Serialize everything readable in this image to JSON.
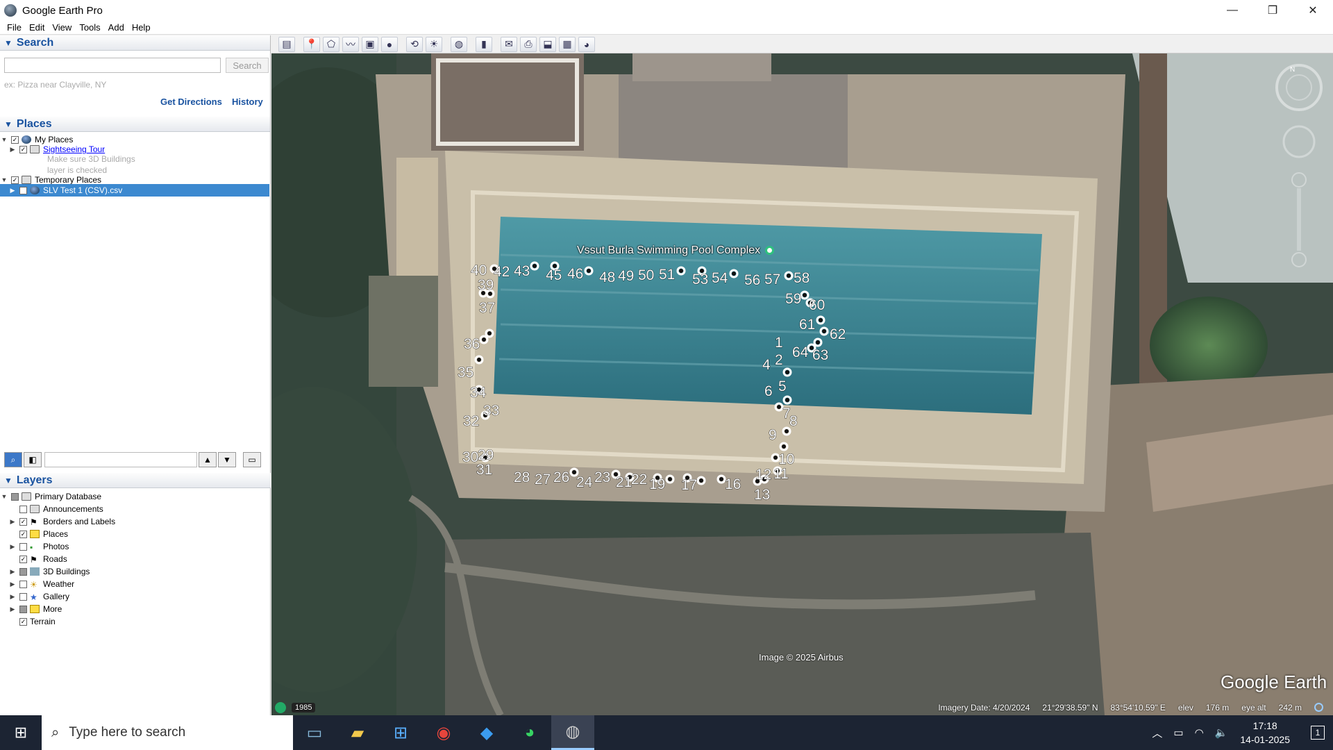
{
  "window": {
    "title": "Google Earth Pro",
    "minimize": "—",
    "maximize": "❐",
    "close": "✕"
  },
  "menu": [
    "File",
    "Edit",
    "View",
    "Tools",
    "Add",
    "Help"
  ],
  "search": {
    "header": "Search",
    "input_value": "",
    "button": "Search",
    "hint": "ex: Pizza near Clayville, NY",
    "get_directions": "Get Directions",
    "history": "History"
  },
  "places": {
    "header": "Places",
    "items": [
      {
        "label": "My Places",
        "checked": true,
        "expanded": true
      },
      {
        "label": "Sightseeing Tour",
        "checked": true,
        "link": true
      },
      {
        "label": "Make sure 3D Buildings"
      },
      {
        "label": "layer is checked"
      },
      {
        "label": "Temporary Places",
        "checked": true,
        "expanded": true
      },
      {
        "label": "SLV Test 1 (CSV).csv",
        "checked": true,
        "selected": true
      }
    ]
  },
  "layers": {
    "header": "Layers",
    "items": [
      {
        "label": "Primary Database",
        "checked": "partial"
      },
      {
        "label": "Announcements",
        "checked": false
      },
      {
        "label": "Borders and Labels",
        "checked": true
      },
      {
        "label": "Places",
        "checked": true
      },
      {
        "label": "Photos",
        "checked": false
      },
      {
        "label": "Roads",
        "checked": true
      },
      {
        "label": "3D Buildings",
        "checked": "partial"
      },
      {
        "label": "Weather",
        "checked": false
      },
      {
        "label": "Gallery",
        "checked": false
      },
      {
        "label": "More",
        "checked": "partial"
      },
      {
        "label": "Terrain",
        "checked": true
      }
    ]
  },
  "toolbar_icons": [
    "sidebar-toggle-icon",
    "placemark-icon",
    "polygon-icon",
    "path-icon",
    "image-overlay-icon",
    "tour-icon",
    "historical-imagery-icon",
    "sunlight-icon",
    "planets-icon",
    "ruler-icon",
    "email-icon",
    "print-icon",
    "save-image-icon",
    "maps-icon",
    "earth-icon"
  ],
  "map": {
    "place_label": "Vssut Burla Swimming Pool Complex",
    "image_credit": "Image © 2025 Airbus",
    "brand": "Google Earth",
    "compass": "N",
    "historical_year": "1985",
    "imagery_date": "Imagery Date: 4/20/2024",
    "lat": "21°29'38.59\" N",
    "lon": "83°54'10.59\" E",
    "elev_label": "elev",
    "elev": "176 m",
    "eye_label": "eye alt",
    "eye_alt": "242 m",
    "point_labels": [
      "1",
      "2",
      "4",
      "5",
      "6",
      "7",
      "8",
      "9",
      "10",
      "11",
      "12",
      "13",
      "16",
      "17",
      "19",
      "21",
      "22",
      "23",
      "24",
      "26",
      "27",
      "28",
      "29",
      "30",
      "31",
      "32",
      "33",
      "34",
      "35",
      "36",
      "37",
      "39",
      "40",
      "42",
      "43",
      "45",
      "46",
      "48",
      "49",
      "50",
      "51",
      "53",
      "54",
      "56",
      "57",
      "58",
      "59",
      "60",
      "61",
      "62",
      "63",
      "64"
    ]
  },
  "taskbar": {
    "search_placeholder": "Type here to search",
    "time": "17:18",
    "date": "14-01-2025",
    "notifications": "1"
  }
}
